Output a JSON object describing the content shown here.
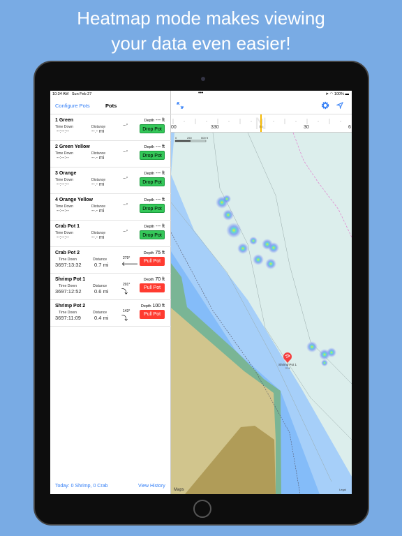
{
  "headline": [
    "Heatmap mode makes viewing",
    "your data even easier!"
  ],
  "status": {
    "time": "10:34 AM",
    "date": "Sun Feb 27",
    "battery": "100%"
  },
  "sidebar": {
    "configure_label": "Configure Pots",
    "title": "Pots",
    "time_down_label": "Time Down",
    "distance_label": "Distance",
    "depth_label": "Depth",
    "pots": [
      {
        "name": "1 Green",
        "time_down": "--:--:--",
        "distance": "--.- mi",
        "heading": "---°",
        "depth": "--- ft",
        "button": "Drop Pot",
        "state": "idle"
      },
      {
        "name": "2 Green Yellow",
        "time_down": "--:--:--",
        "distance": "--.- mi",
        "heading": "---°",
        "depth": "--- ft",
        "button": "Drop Pot",
        "state": "idle"
      },
      {
        "name": "3 Orange",
        "time_down": "--:--:--",
        "distance": "--.- mi",
        "heading": "---°",
        "depth": "--- ft",
        "button": "Drop Pot",
        "state": "idle"
      },
      {
        "name": "4 Orange Yellow",
        "time_down": "--:--:--",
        "distance": "--.- mi",
        "heading": "---°",
        "depth": "--- ft",
        "button": "Drop Pot",
        "state": "idle"
      },
      {
        "name": "Crab Pot 1",
        "time_down": "--:--:--",
        "distance": "--.- mi",
        "heading": "---°",
        "depth": "--- ft",
        "button": "Drop Pot",
        "state": "idle"
      },
      {
        "name": "Crab Pot 2",
        "time_down": "3697:13:32",
        "distance": "0.7 mi",
        "heading": "279°",
        "arrow": "🡐",
        "depth": "75 ft",
        "button": "Pull Pot",
        "state": "active"
      },
      {
        "name": "Shrimp Pot 1",
        "time_down": "3697:12:52",
        "distance": "0.6 mi",
        "heading": "201°",
        "arrow": "⤵",
        "depth": "70 ft",
        "button": "Pull Pot",
        "state": "active"
      },
      {
        "name": "Shrimp Pot 2",
        "time_down": "3697:11:09",
        "distance": "0.4 mi",
        "heading": "143°",
        "arrow": "⤵",
        "depth": "100 ft",
        "button": "Pull Pot",
        "state": "active"
      }
    ],
    "footer_today": "Today: 0 Shrimp, 0 Crab",
    "footer_history": "View History"
  },
  "map": {
    "compass_ticks": [
      "00",
      "330",
      "0",
      "30",
      "6"
    ],
    "compass_letter": "N",
    "scale": [
      "0",
      "250",
      "500 ft"
    ],
    "pin_label": "Shrimp Pot 1",
    "pin_depth": "70 ft",
    "maps_label": "Maps",
    "legal_label": "Legal",
    "colors": {
      "accent": "#2f7cf6",
      "drop": "#34c759",
      "pull": "#ff3b30",
      "heading": "#f5b800"
    }
  }
}
